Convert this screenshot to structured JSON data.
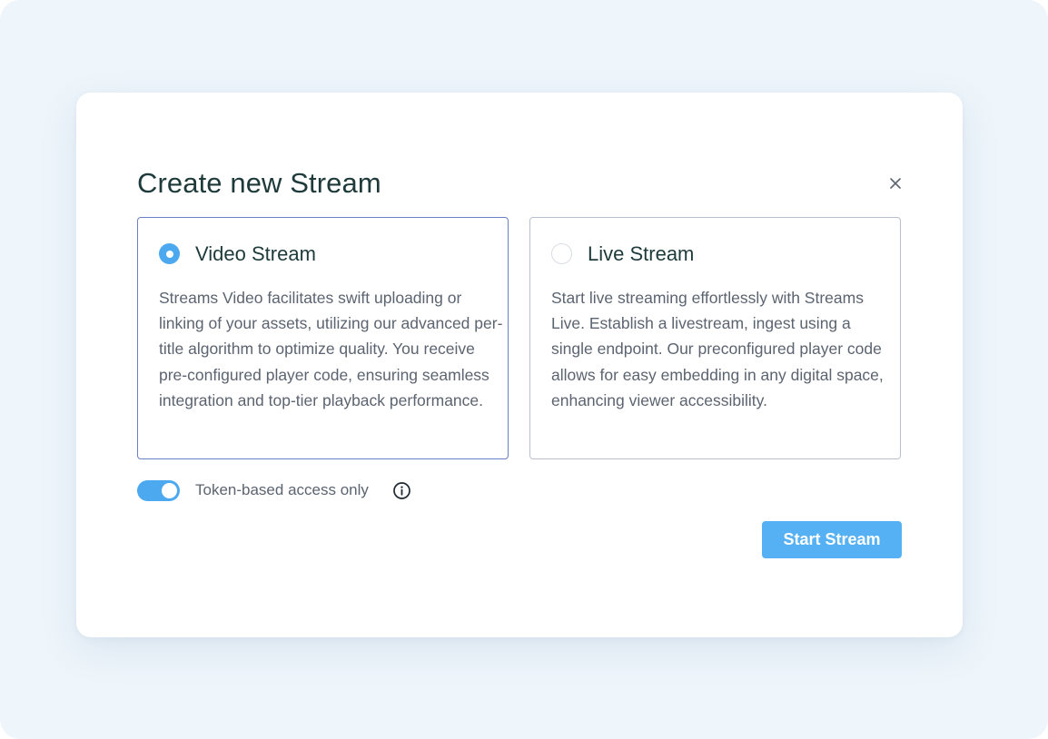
{
  "dialog": {
    "title": "Create new Stream",
    "close_icon": "close-icon"
  },
  "options": [
    {
      "title": "Video Stream",
      "selected": true,
      "description": "Streams Video facilitates swift uploading or linking of your assets, utilizing our advanced per-title algorithm to optimize quality. You receive pre-configured player code, ensuring seamless integration and top-tier playback performance."
    },
    {
      "title": "Live Stream",
      "selected": false,
      "description": "Start live streaming effortlessly with Streams Live. Establish a livestream, ingest using a single endpoint. Our preconfigured player code allows for easy embedding in any digital space, enhancing viewer accessibility."
    }
  ],
  "token_access": {
    "label": "Token-based access only",
    "enabled": true,
    "info_icon": "info-icon"
  },
  "actions": {
    "start_label": "Start Stream"
  },
  "colors": {
    "accent": "#4ca8ef",
    "button": "#55b1f3",
    "selected_border": "#6b7fc4",
    "backdrop": "#eef5fb"
  }
}
